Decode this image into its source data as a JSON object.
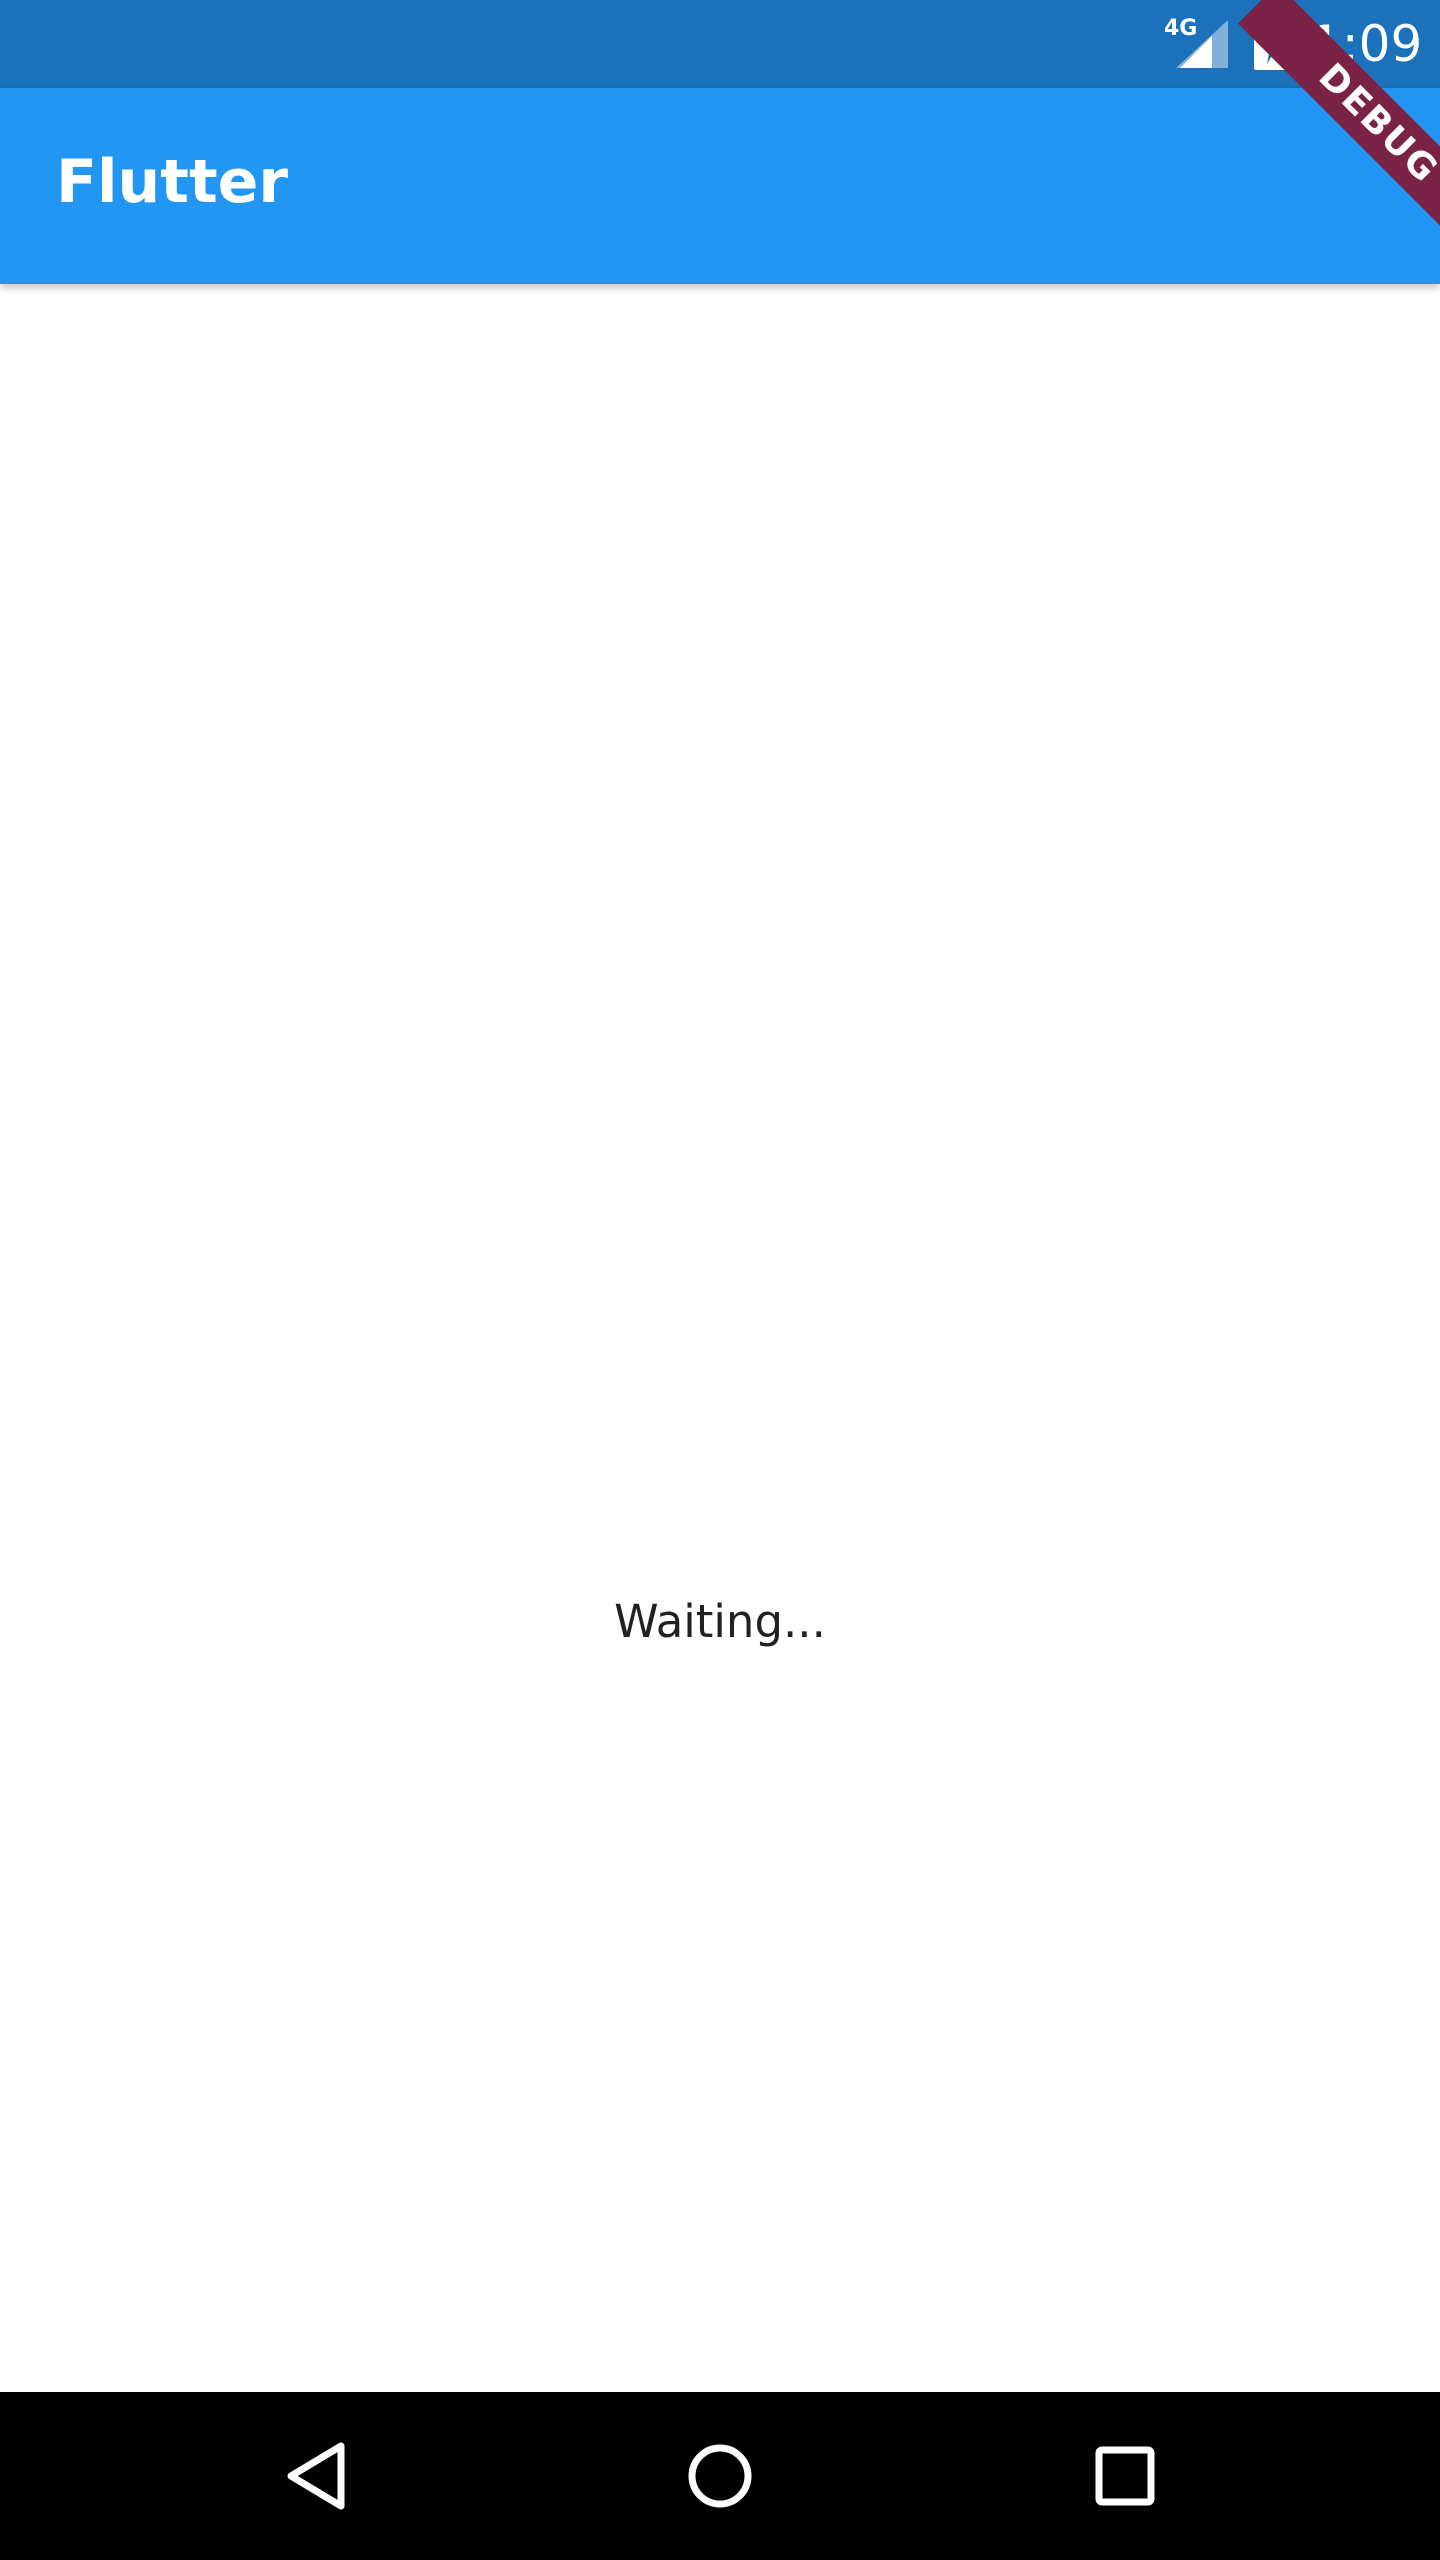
{
  "status_bar": {
    "network_type": "4G",
    "time": "1:09",
    "icons": [
      "signal-icon",
      "battery-charging-icon"
    ]
  },
  "debug_banner": {
    "label": "DEBUG"
  },
  "app_bar": {
    "title": "Flutter"
  },
  "body": {
    "message": "Waiting..."
  },
  "nav_bar": {
    "icons": [
      "back-icon",
      "home-icon",
      "recents-icon"
    ]
  },
  "colors": {
    "status_bar": "#1b72ba",
    "app_bar": "#2196f3",
    "background": "#ffffff",
    "text": "#212121",
    "debug_banner": "#7b2346",
    "nav_bar": "#000000"
  }
}
